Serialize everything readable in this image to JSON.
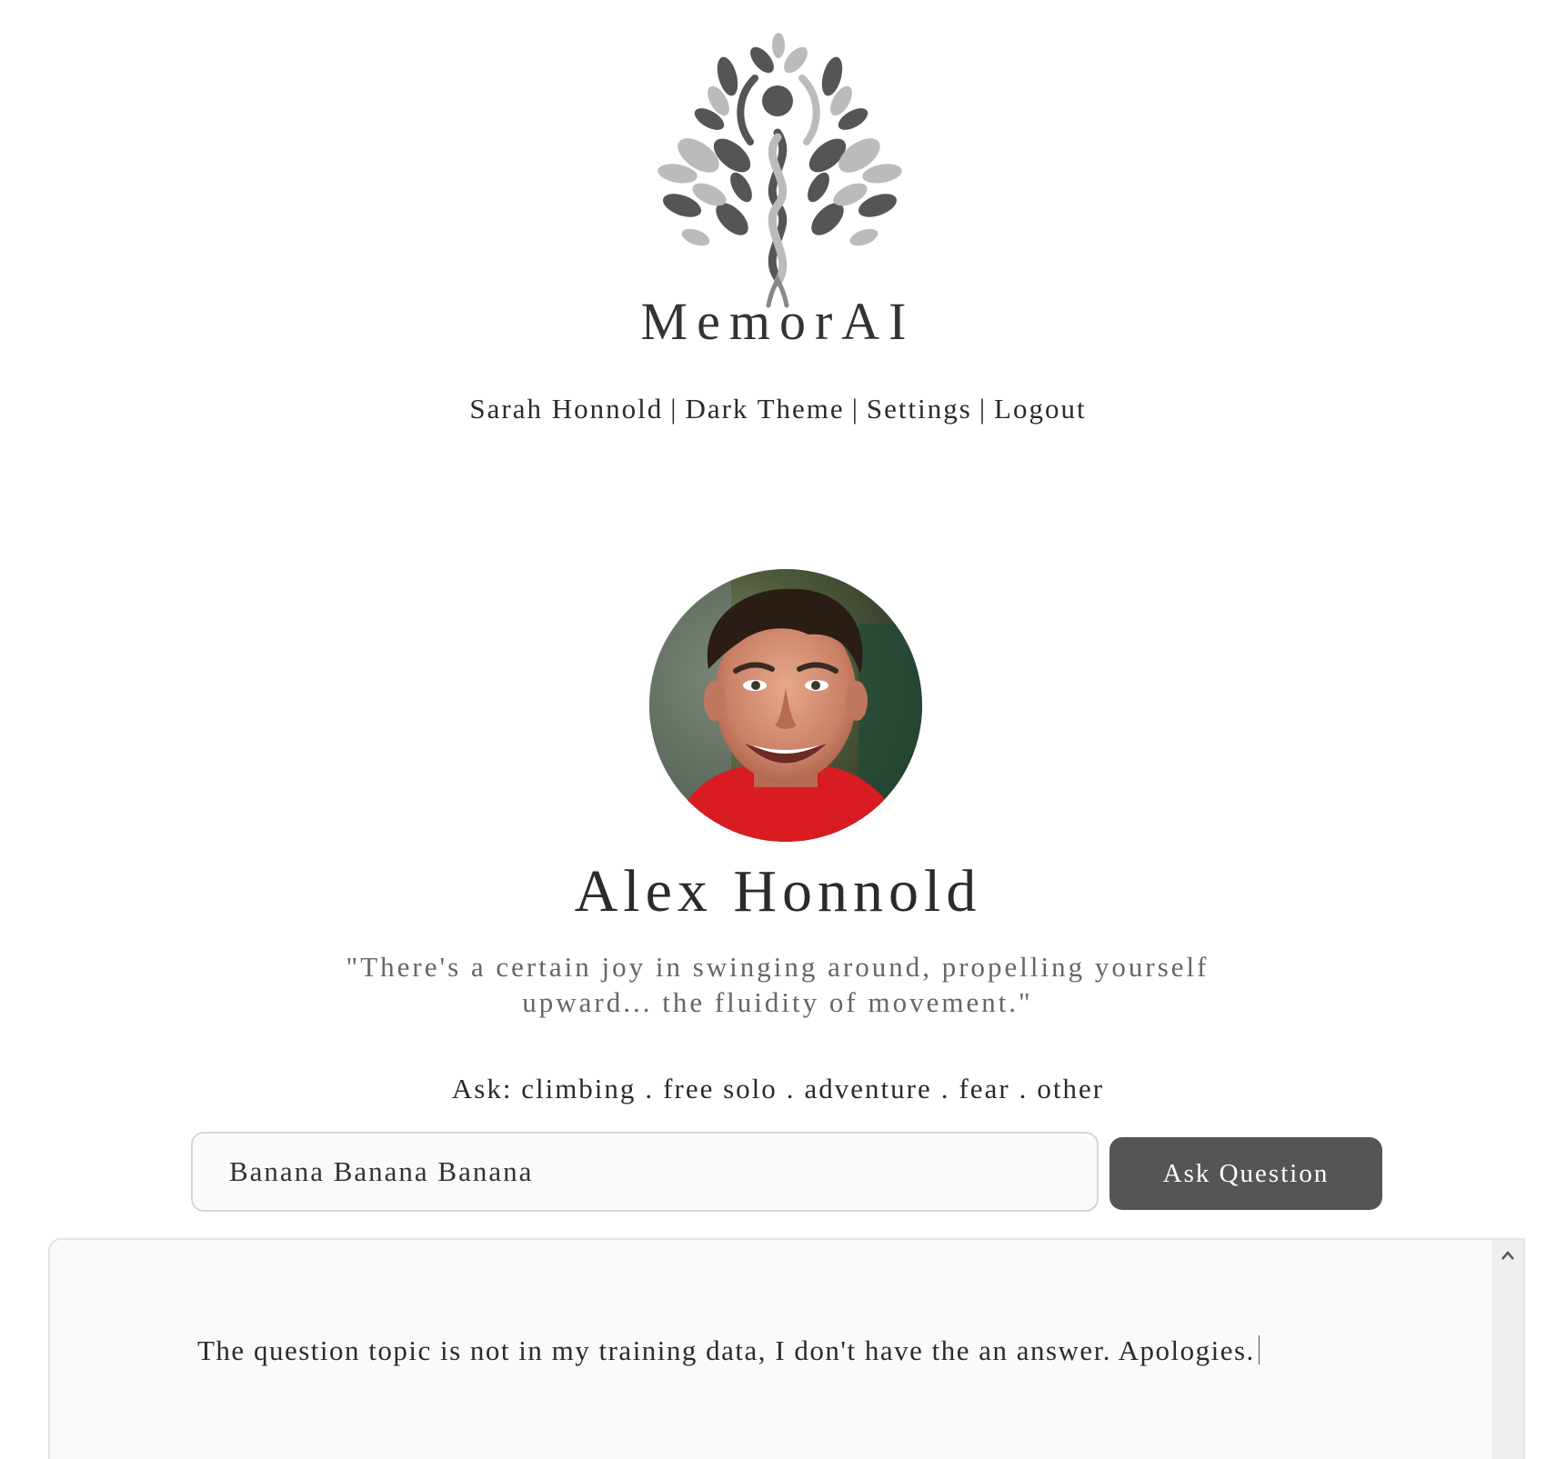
{
  "brand": {
    "wordmark": "MemorAI",
    "logo_icon": "tree-logo-icon"
  },
  "nav": {
    "user": "Sarah Honnold",
    "theme": "Dark Theme",
    "settings": "Settings",
    "logout": "Logout",
    "separator": "|"
  },
  "profile": {
    "name": "Alex Honnold",
    "quote": "\"There's a certain joy in swinging around, propelling yourself upward... the fluidity of movement.\"",
    "avatar_icon": "portrait-avatar"
  },
  "topics": {
    "prefix": "Ask:",
    "items": [
      "climbing",
      "free solo",
      "adventure",
      "fear",
      "other"
    ],
    "separator": "."
  },
  "ask": {
    "input_value": "Banana Banana Banana",
    "button_label": "Ask Question"
  },
  "answer": {
    "text": "The question topic is not in my training data, I don't have the an answer. Apologies."
  },
  "colors": {
    "button_bg": "#555555",
    "panel_bg": "#fafafa",
    "text": "#2b2b2b",
    "quote_text": "#666666"
  }
}
